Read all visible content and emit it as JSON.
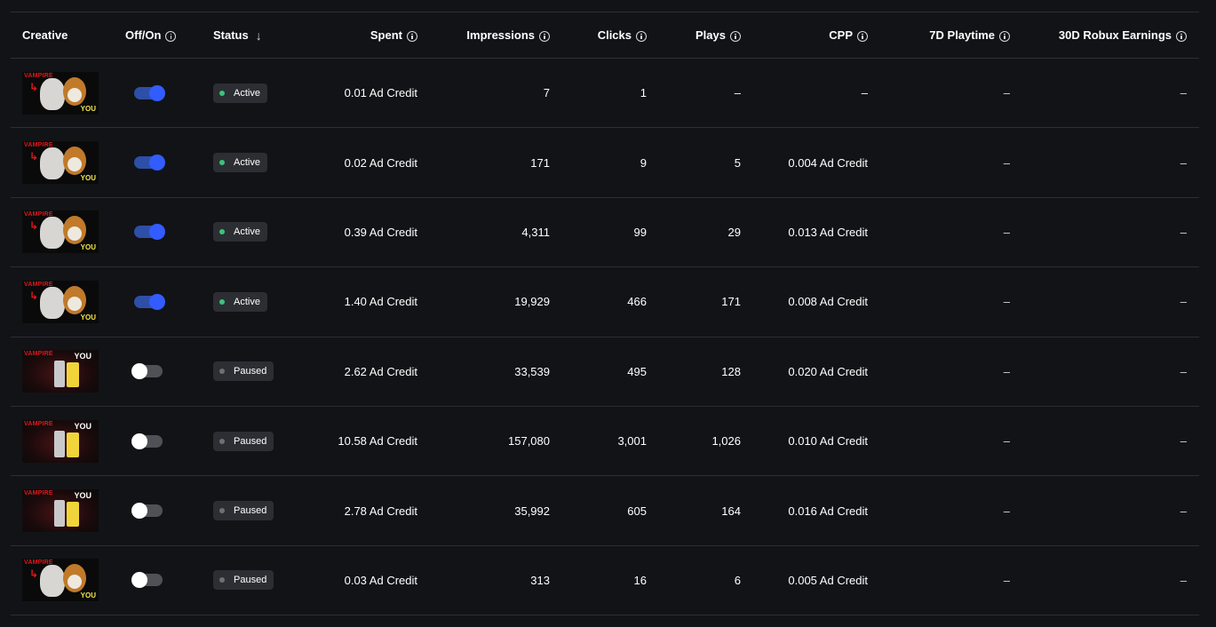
{
  "colors": {
    "background": "#121317",
    "divider": "#2c2e33",
    "toggle_on": "#335cff",
    "status_active": "#39c57a",
    "status_paused": "#6e7075"
  },
  "headers": {
    "creative": "Creative",
    "onoff": "Off/On",
    "status": "Status",
    "spent": "Spent",
    "impressions": "Impressions",
    "clicks": "Clicks",
    "plays": "Plays",
    "cpp": "CPP",
    "playtime": "7D Playtime",
    "robux": "30D Robux Earnings"
  },
  "thumb_text": {
    "vampire": "VAMPIRE",
    "you": "YOU"
  },
  "rows": [
    {
      "thumb": "light",
      "on": true,
      "status": "Active",
      "spent": "0.01 Ad Credit",
      "impressions": "7",
      "clicks": "1",
      "plays": "–",
      "cpp": "–",
      "playtime": "–",
      "robux": "–"
    },
    {
      "thumb": "light",
      "on": true,
      "status": "Active",
      "spent": "0.02 Ad Credit",
      "impressions": "171",
      "clicks": "9",
      "plays": "5",
      "cpp": "0.004 Ad Credit",
      "playtime": "–",
      "robux": "–"
    },
    {
      "thumb": "light",
      "on": true,
      "status": "Active",
      "spent": "0.39 Ad Credit",
      "impressions": "4,311",
      "clicks": "99",
      "plays": "29",
      "cpp": "0.013 Ad Credit",
      "playtime": "–",
      "robux": "–"
    },
    {
      "thumb": "light",
      "on": true,
      "status": "Active",
      "spent": "1.40 Ad Credit",
      "impressions": "19,929",
      "clicks": "466",
      "plays": "171",
      "cpp": "0.008 Ad Credit",
      "playtime": "–",
      "robux": "–"
    },
    {
      "thumb": "dark",
      "on": false,
      "status": "Paused",
      "spent": "2.62 Ad Credit",
      "impressions": "33,539",
      "clicks": "495",
      "plays": "128",
      "cpp": "0.020 Ad Credit",
      "playtime": "–",
      "robux": "–"
    },
    {
      "thumb": "dark",
      "on": false,
      "status": "Paused",
      "spent": "10.58 Ad Credit",
      "impressions": "157,080",
      "clicks": "3,001",
      "plays": "1,026",
      "cpp": "0.010 Ad Credit",
      "playtime": "–",
      "robux": "–"
    },
    {
      "thumb": "dark",
      "on": false,
      "status": "Paused",
      "spent": "2.78 Ad Credit",
      "impressions": "35,992",
      "clicks": "605",
      "plays": "164",
      "cpp": "0.016 Ad Credit",
      "playtime": "–",
      "robux": "–"
    },
    {
      "thumb": "light",
      "on": false,
      "status": "Paused",
      "spent": "0.03 Ad Credit",
      "impressions": "313",
      "clicks": "16",
      "plays": "6",
      "cpp": "0.005 Ad Credit",
      "playtime": "–",
      "robux": "–"
    }
  ]
}
